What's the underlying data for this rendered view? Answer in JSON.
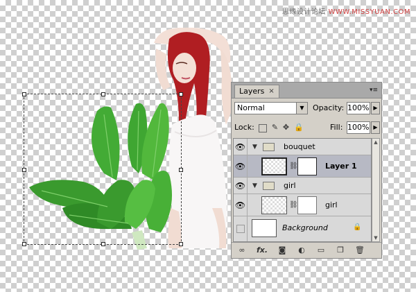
{
  "watermark": {
    "site_cn": "思缘设计论坛",
    "url": "WWW.MISSYUAN.COM"
  },
  "panel": {
    "tab_label": "Layers",
    "tab_close": "×",
    "menu_glyph": "▾≡",
    "blend_mode": "Normal",
    "opacity_label": "Opacity:",
    "opacity_value": "100%",
    "lock_label": "Lock:",
    "fill_label": "Fill:",
    "fill_value": "100%",
    "layers": [
      {
        "name": "bouquet",
        "type": "group",
        "visible": true
      },
      {
        "name": "Layer 1",
        "type": "layer-mask",
        "visible": true,
        "selected": true
      },
      {
        "name": "girl",
        "type": "group",
        "visible": true
      },
      {
        "name": "girl",
        "type": "layer-mask",
        "visible": true
      },
      {
        "name": "Background",
        "type": "background",
        "visible": false,
        "locked": true
      }
    ]
  },
  "icons": {
    "eye": "eye-icon",
    "folder": "folder-icon",
    "chain": "chain-icon",
    "lock": "lock-icon",
    "link_layers": "link-layers-icon",
    "fx": "fx-icon",
    "add_mask": "add-mask-icon",
    "adjustment": "adjustment-layer-icon",
    "new_group": "new-group-icon",
    "new_layer": "new-layer-icon",
    "trash": "trash-icon"
  },
  "bottom_bar": {
    "fx_label": "fx."
  },
  "colors": {
    "panel_bg": "#d4d0c8",
    "selected_row": "#b7b9c4",
    "leaf_green": "#3a9a2e",
    "hair": "#b01e22"
  }
}
